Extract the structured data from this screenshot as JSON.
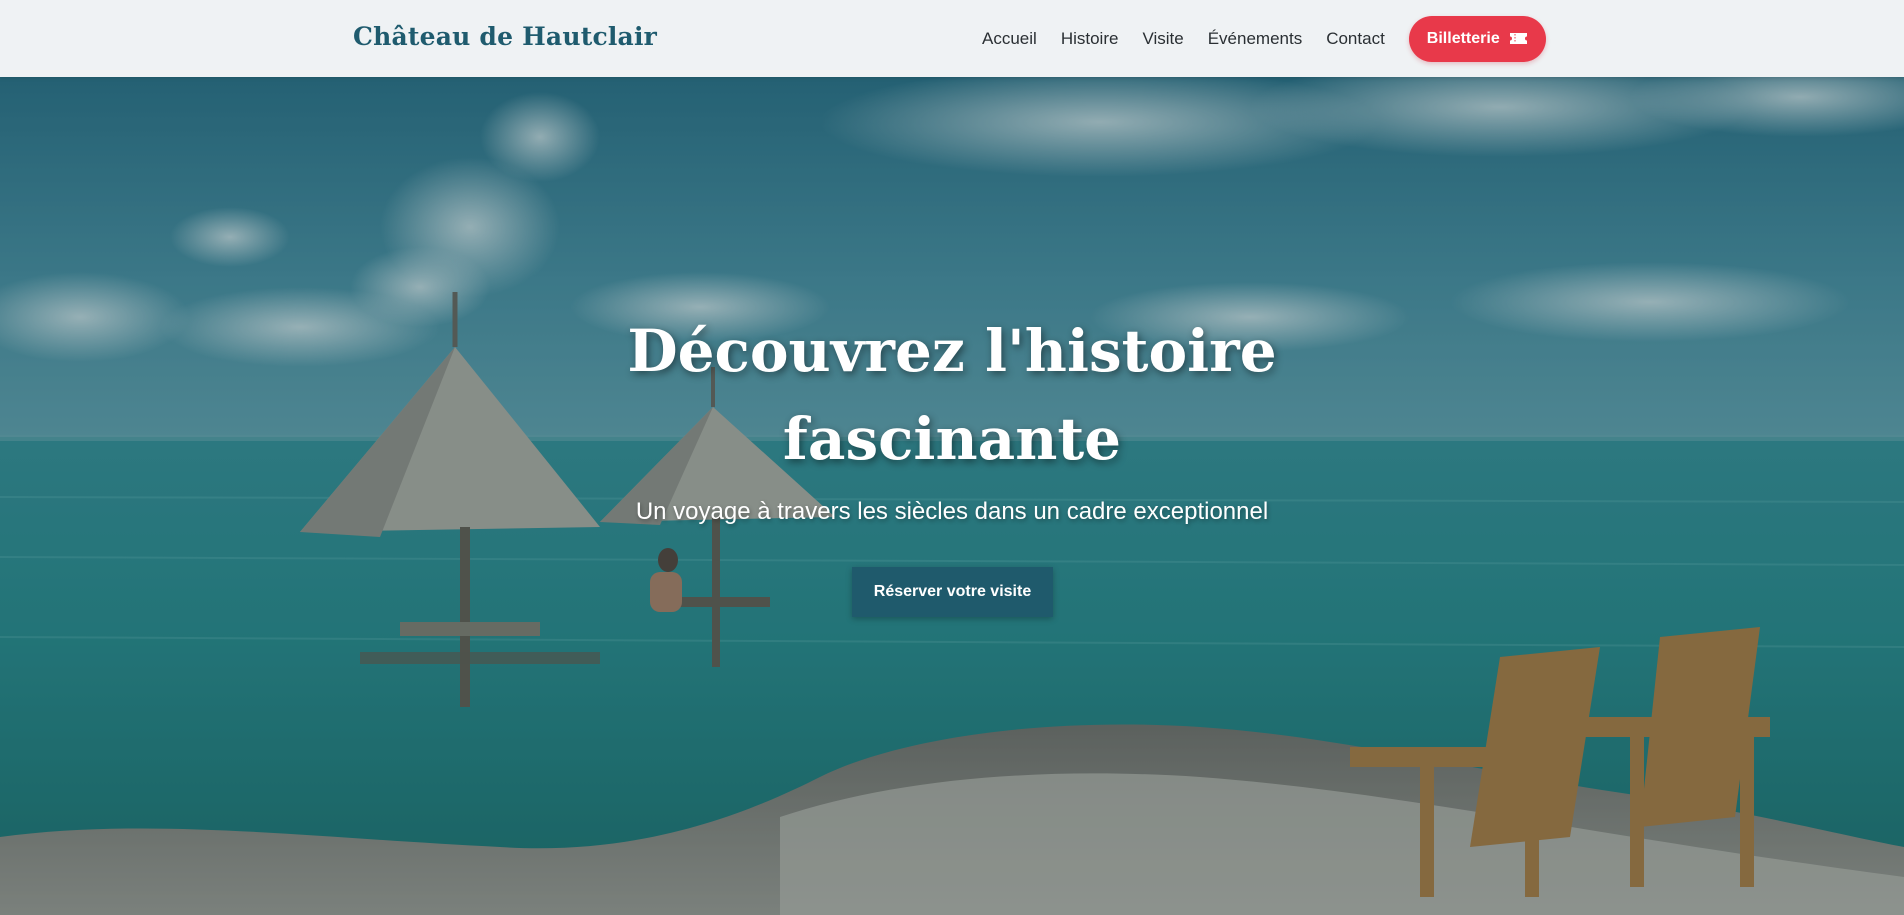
{
  "header": {
    "brand": "Château de Hautclair",
    "nav": {
      "home": "Accueil",
      "history": "Histoire",
      "visit": "Visite",
      "events": "Événements",
      "contact": "Contact"
    },
    "ticket_button": "Billetterie",
    "ticket_icon": "ticket-icon"
  },
  "hero": {
    "title_line1": "Découvrez l'histoire",
    "title_line2": "fascinante",
    "subtitle": "Un voyage à travers les siècles dans un cadre exceptionnel",
    "cta": "Réserver votre visite",
    "background": "beach-scene-with-straw-umbrellas-and-wooden-chairs"
  },
  "colors": {
    "brand": "#1f5b6e",
    "ticket_button": "#e8394a",
    "cta_button": "#1f5a6c",
    "header_bg": "#f6f8f9"
  }
}
